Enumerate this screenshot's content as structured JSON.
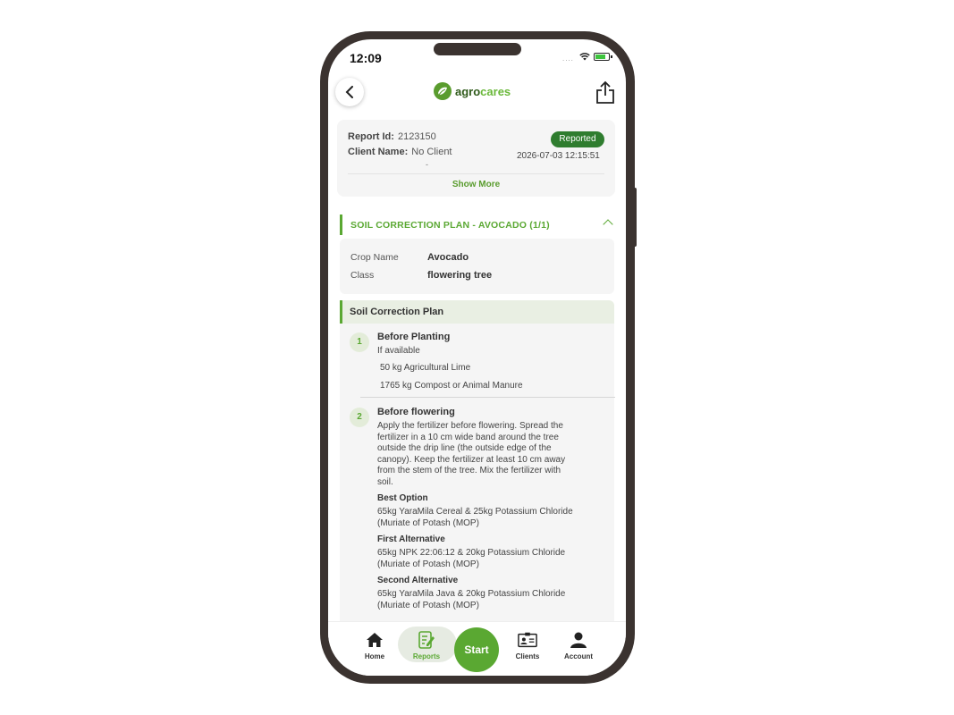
{
  "status_bar": {
    "time": "12:09",
    "signal": "...."
  },
  "header": {
    "logo_part1": "agro",
    "logo_part2": "cares"
  },
  "report": {
    "id_label": "Report Id:",
    "id_value": "2123150",
    "client_label": "Client Name:",
    "client_value": "No Client",
    "client_extra": "-",
    "status": "Reported",
    "date": "2026-07-03 12:15:51",
    "show_more": "Show More"
  },
  "section": {
    "title": "SOIL CORRECTION PLAN - AVOCADO (1/1)"
  },
  "crop": {
    "name_label": "Crop Name",
    "name_value": "Avocado",
    "class_label": "Class",
    "class_value": "flowering tree"
  },
  "plan": {
    "title": "Soil Correction Plan",
    "steps": [
      {
        "num": "1",
        "title": "Before Planting",
        "subtitle": "If available",
        "items": [
          "50 kg Agricultural Lime",
          "1765 kg Compost or Animal Manure"
        ]
      },
      {
        "num": "2",
        "title": "Before flowering",
        "description": [
          "Apply the fertilizer before flowering. Spread the",
          "fertilizer in a 10 cm wide band around the tree",
          "outside the drip line (the outside edge of the",
          "canopy). Keep the fertilizer at least 10 cm away",
          "from the stem of the tree. Mix the fertilizer with",
          "soil."
        ],
        "options": [
          {
            "label": "Best Option",
            "lines": [
              "65kg YaraMila Cereal & 25kg Potassium Chloride",
              "(Muriate of Potash (MOP)"
            ]
          },
          {
            "label": "First Alternative",
            "lines": [
              "65kg NPK 22:06:12 & 20kg Potassium Chloride",
              "(Muriate of Potash (MOP)"
            ]
          },
          {
            "label": "Second Alternative",
            "lines": [
              "65kg YaraMila Java & 20kg Potassium Chloride",
              "(Muriate of Potash (MOP)"
            ]
          }
        ]
      }
    ]
  },
  "tabbar": {
    "home": "Home",
    "reports": "Reports",
    "start": "Start",
    "clients": "Clients",
    "account": "Account"
  },
  "colors": {
    "brand_green": "#5aa832",
    "badge_green": "#2f7d2f",
    "frame": "#3b3330"
  }
}
